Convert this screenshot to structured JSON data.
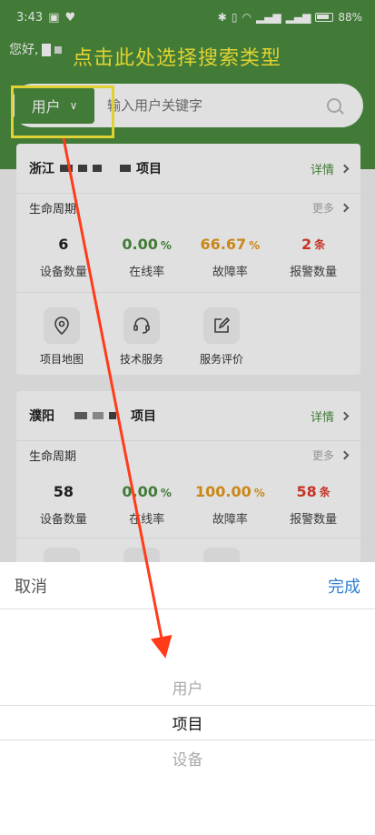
{
  "status": {
    "time": "3:43",
    "signal": "ᯤ",
    "battery": "88%"
  },
  "header": {
    "greeting": "您好,",
    "annotation": "点击此处选择搜索类型"
  },
  "search": {
    "type_label": "用户",
    "placeholder": "输入用户关键字"
  },
  "cards": [
    {
      "province": "浙江",
      "suffix": "项目",
      "detail": "详情",
      "lifecycle": "生命周期",
      "more": "更多",
      "stats": [
        {
          "value": "6",
          "unit": "",
          "label": "设备数量"
        },
        {
          "value": "0.00",
          "unit": "%",
          "label": "在线率"
        },
        {
          "value": "66.67",
          "unit": "%",
          "label": "故障率"
        },
        {
          "value": "2",
          "unit": "条",
          "label": "报警数量"
        }
      ],
      "tools": [
        "项目地图",
        "技术服务",
        "服务评价"
      ]
    },
    {
      "province": "濮阳",
      "suffix": "项目",
      "detail": "详情",
      "lifecycle": "生命周期",
      "more": "更多",
      "stats": [
        {
          "value": "58",
          "unit": "",
          "label": "设备数量"
        },
        {
          "value": "0.00",
          "unit": "%",
          "label": "在线率"
        },
        {
          "value": "100.00",
          "unit": "%",
          "label": "故障率"
        },
        {
          "value": "58",
          "unit": "条",
          "label": "报警数量"
        }
      ]
    }
  ],
  "picker": {
    "cancel": "取消",
    "done": "完成",
    "options": [
      "用户",
      "项目",
      "设备"
    ]
  },
  "colors": {
    "brand": "#4a8c3f",
    "annotation": "#ffef3a",
    "arrow": "#ff3b1a",
    "done": "#2f7fd6"
  }
}
